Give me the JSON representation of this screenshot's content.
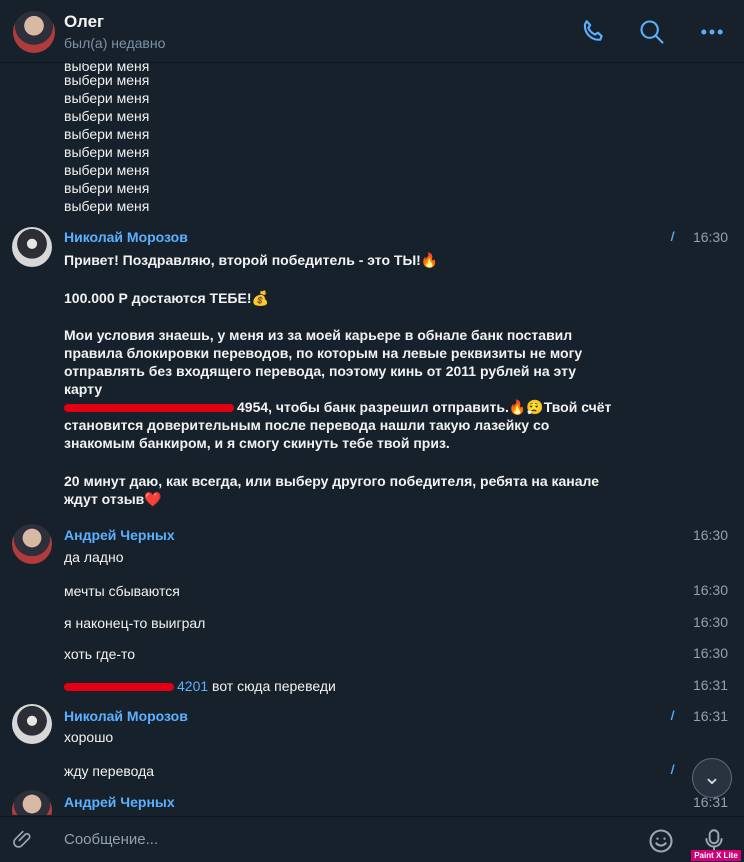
{
  "header": {
    "title": "Олег",
    "status": "был(а) недавно"
  },
  "spam_lines": [
    "выбери меня",
    "выбери меня",
    "выбери меня",
    "выбери меня",
    "выбери меня",
    "выбери меня",
    "выбери меня",
    "выбери меня",
    "выбери меня"
  ],
  "messages": [
    {
      "sender": "Николай Морозов",
      "time": "16:30",
      "check": "//",
      "p1": "Привет! Поздравляю, второй победитель - это ТЫ!🔥",
      "p2": "100.000 Р достаются ТЕБЕ!💰",
      "p3a": "Мои условия знаешь, у меня из за моей карьере в обнале банк поставил",
      "p3b": "правила блокировки переводов, по которым на левые реквизиты не могу",
      "p3c": "отправлять без входящего перевода, поэтому кинь от 2011 рублей на эту",
      "p3d": "карту",
      "p3e": "4954, чтобы банк разрешил отправить.🔥😮‍💨Твой счёт",
      "p3f": "становится доверительным после перевода нашли такую лазейку со",
      "p3g": "знакомым банкиром, и я смогу скинуть тебе твой приз.",
      "p4a": "20 минут даю, как всегда, или выберу другого победителя, ребята на канале",
      "p4b": "ждут отзыв❤️"
    },
    {
      "sender": "Андрей Черных",
      "text": "да ладно",
      "time": "16:30"
    },
    {
      "text": "мечты сбываются",
      "time": "16:30"
    },
    {
      "text": "я наконец-то выиграл",
      "time": "16:30"
    },
    {
      "text": "хоть где-то",
      "time": "16:30"
    },
    {
      "text_num": "4201",
      "text": " вот сюда переведи",
      "time": "16:31"
    },
    {
      "sender": "Николай Морозов",
      "text": "хорошо",
      "time": "16:31",
      "check": "//"
    },
    {
      "text": "жду перевода",
      "check": "//"
    },
    {
      "sender": "Андрей Черных",
      "time": "16:31"
    }
  ],
  "input": {
    "placeholder": "Сообщение..."
  },
  "badge": "Paint X Lite",
  "icons": [
    "phone-icon",
    "search-icon",
    "more-icon",
    "attach-icon",
    "emoji-icon",
    "mic-icon",
    "chevron-down-icon"
  ],
  "colors": {
    "background": "#17212b",
    "accent": "#5bb0ff",
    "redaction": "#e30013"
  }
}
